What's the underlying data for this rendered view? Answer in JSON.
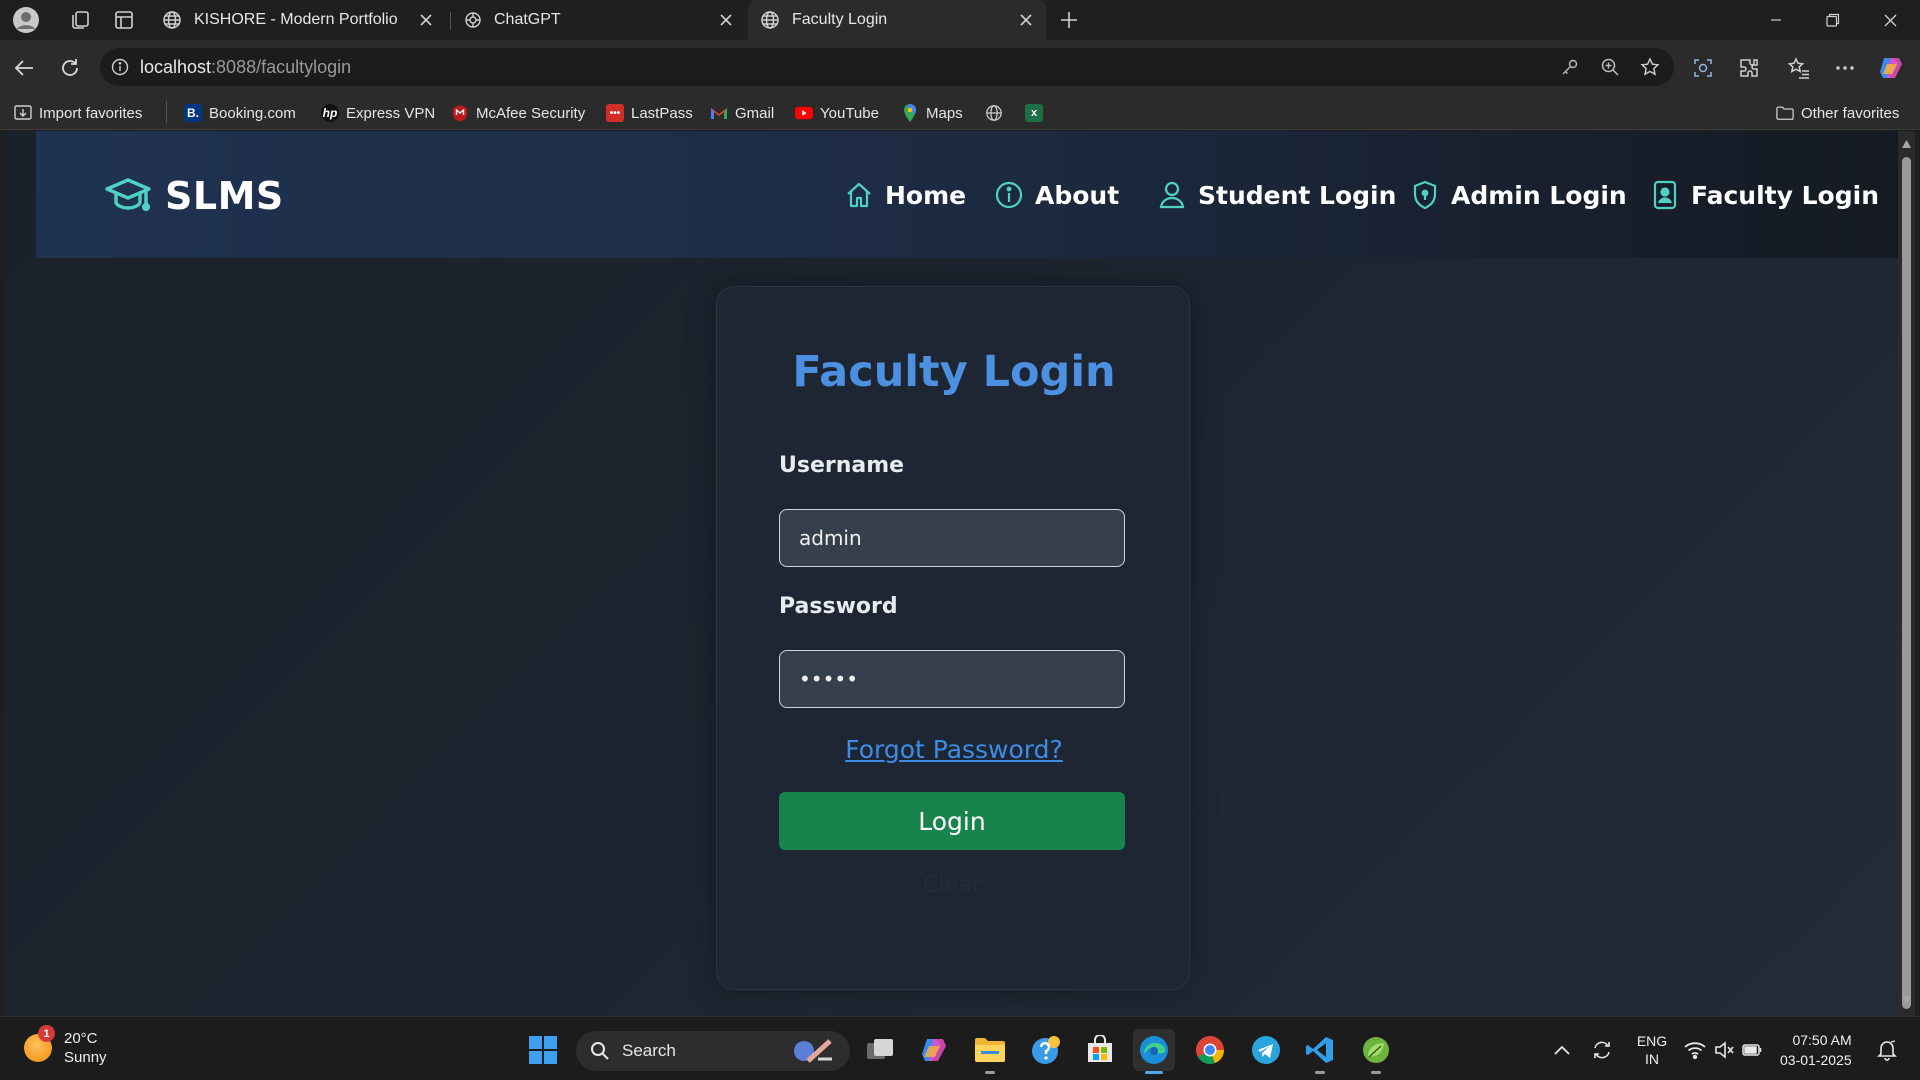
{
  "browser": {
    "tabs": [
      {
        "title": "KISHORE - Modern Portfolio",
        "active": false
      },
      {
        "title": "ChatGPT",
        "active": false
      },
      {
        "title": "Faculty Login",
        "active": true
      }
    ],
    "address": {
      "host": "localhost",
      "path": ":8088/facultylogin"
    },
    "bookmarks": [
      {
        "label": "Import favorites",
        "icon": "import-icon"
      },
      {
        "label": "Booking.com",
        "icon": "booking-icon",
        "color": "#003580"
      },
      {
        "label": "Express VPN",
        "icon": "hp-icon"
      },
      {
        "label": "McAfee Security",
        "icon": "mcafee-icon",
        "color": "#c01818"
      },
      {
        "label": "LastPass",
        "icon": "lastpass-icon",
        "color": "#d32d27"
      },
      {
        "label": "Gmail",
        "icon": "gmail-icon"
      },
      {
        "label": "YouTube",
        "icon": "youtube-icon",
        "color": "#ff0000"
      },
      {
        "label": "Maps",
        "icon": "maps-icon"
      },
      {
        "label": "Other favorites",
        "icon": "folder-icon"
      }
    ]
  },
  "site": {
    "brand": "SLMS",
    "nav": [
      {
        "label": "Home",
        "icon": "home-icon"
      },
      {
        "label": "About",
        "icon": "info-icon"
      },
      {
        "label": "Student Login",
        "icon": "user-icon"
      },
      {
        "label": "Admin Login",
        "icon": "shield-icon"
      },
      {
        "label": "Faculty Login",
        "icon": "id-badge-icon"
      }
    ],
    "accent": "#4d8fe0",
    "login_color": "#18834a"
  },
  "form": {
    "title": "Faculty Login",
    "username_label": "Username",
    "username_value": "admin",
    "password_label": "Password",
    "password_value": "admin",
    "forgot": "Forgot Password?",
    "login": "Login",
    "clear": "Clear"
  },
  "taskbar": {
    "weather": {
      "temp": "20°C",
      "condition": "Sunny",
      "badge": "1"
    },
    "search": "Search",
    "lang": "ENG",
    "region": "IN",
    "time": "07:50 AM",
    "date": "03-01-2025"
  }
}
